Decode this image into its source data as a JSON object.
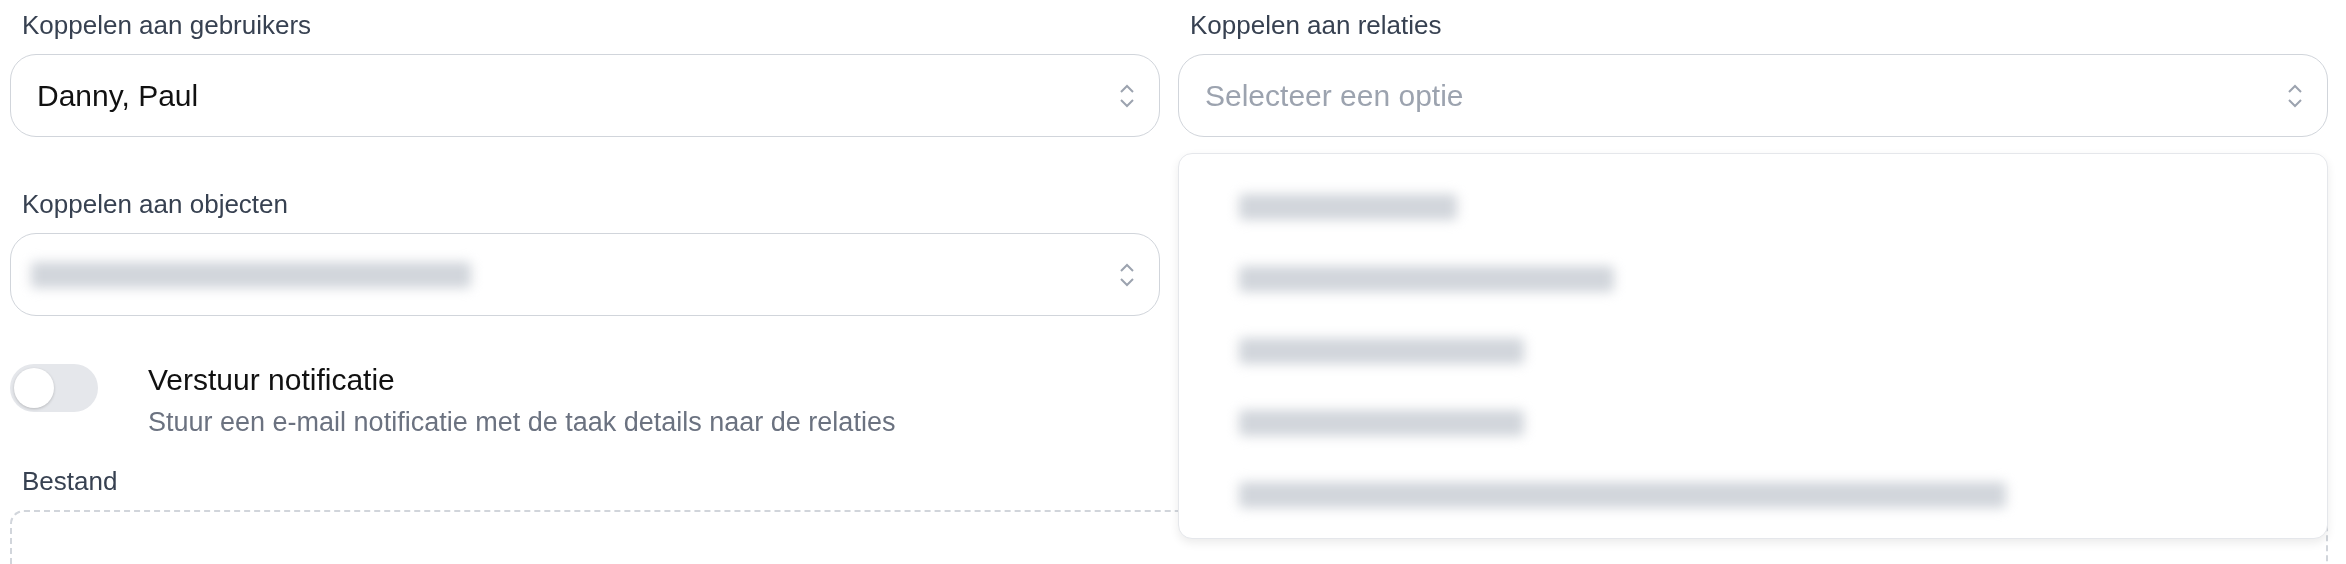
{
  "fields": [
    {
      "label": "Koppelen aan gebruikers",
      "value": "Danny, Paul"
    },
    {
      "label": "Koppelen aan relaties",
      "placeholder": "Selecteer een optie",
      "expanded": true,
      "options": [
        {
          "kind": "redacted"
        },
        {
          "kind": "redacted"
        },
        {
          "kind": "redacted"
        },
        {
          "kind": "redacted"
        },
        {
          "kind": "redacted"
        }
      ]
    },
    {
      "label": "Koppelen aan objecten",
      "redacted_value": true
    }
  ],
  "notification": {
    "title": "Verstuur notificatie",
    "description": "Stuur een e-mail notificatie met de taak details naar de relaties",
    "on": false
  },
  "file": {
    "label": "Bestand"
  }
}
